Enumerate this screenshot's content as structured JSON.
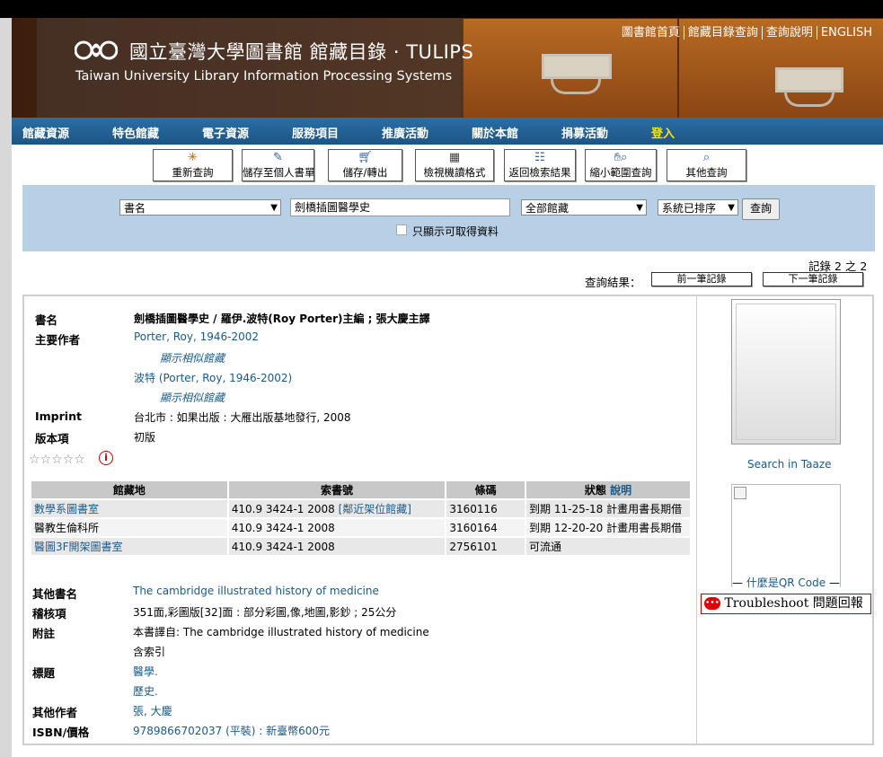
{
  "header": {
    "title_cn": "國立臺灣大學圖書館 館藏目錄 · TULIPS",
    "title_en": "Taiwan University Library Information Processing Systems",
    "top_links": [
      "圖書館首頁",
      "館藏目錄查詢",
      "查詢說明",
      "ENGLISH"
    ]
  },
  "nav": {
    "items": [
      "館藏資源",
      "特色館藏",
      "電子資源",
      "服務項目",
      "推廣活動",
      "關於本館",
      "捐募活動"
    ],
    "login": "登入"
  },
  "toolbar": {
    "buttons": [
      {
        "label": "重新查詢",
        "icon": "new-search-icon"
      },
      {
        "label": "儲存至個人書單",
        "icon": "save-list-icon"
      },
      {
        "label": "儲存/轉出",
        "icon": "cart-icon"
      },
      {
        "label": "檢視機讀格式",
        "icon": "marc-icon"
      },
      {
        "label": "返回檢索結果",
        "icon": "back-results-icon"
      },
      {
        "label": "縮小範圍查詢",
        "icon": "narrow-search-icon"
      },
      {
        "label": "其他查詢",
        "icon": "magnifier-icon"
      }
    ]
  },
  "search": {
    "field_select": "書名",
    "query": "劍橋插圖醫學史",
    "scope_select": "全部館藏",
    "sort_select": "系統已排序",
    "submit": "查詢",
    "available_only": "只顯示可取得資料",
    "available_only_checked": false
  },
  "record_nav": {
    "position": "記錄 2 之 2",
    "results_label": "查詢結果：",
    "prev": "前一筆記錄",
    "next": "下一筆記錄"
  },
  "record": {
    "title_label": "書名",
    "title_value": "劍橋插圖醫學史 / 羅伊.波特(Roy Porter)主編 ; 張大慶主譯",
    "author_label": "主要作者",
    "authors": [
      {
        "name": "Porter, Roy, 1946-2002",
        "similar": "顯示相似館藏"
      },
      {
        "name": "波特 (Porter, Roy, 1946-2002)",
        "similar": "顯示相似館藏"
      }
    ],
    "imprint_label": "Imprint",
    "imprint_value": "台北市 : 如果出版 : 大雁出版基地發行, 2008",
    "edition_label": "版本項",
    "edition_value": "初版",
    "rating": 0,
    "rating_max": 5
  },
  "holdings": {
    "headers": [
      "館藏地",
      "索書號",
      "條碼",
      "狀態"
    ],
    "status_help": "說明",
    "rows": [
      {
        "location": "數學系圖書室",
        "callno": "410.9 3424-1 2008",
        "shelf": "[鄰近架位館藏]",
        "barcode": "3160116",
        "status": "到期 11-25-18 計畫用書長期借",
        "location_link": true
      },
      {
        "location": "醫教生倫科所",
        "callno": "410.9 3424-1 2008",
        "shelf": "",
        "barcode": "3160164",
        "status": "到期 12-20-20 計畫用書長期借",
        "location_link": false
      },
      {
        "location": "醫圖3F開架圖書室",
        "callno": "410.9 3424-1 2008",
        "shelf": "",
        "barcode": "2756101",
        "status": "可流通",
        "location_link": true
      }
    ]
  },
  "details": {
    "other_title_label": "其他書名",
    "other_title": "The cambridge illustrated history of medicine",
    "collation_label": "稽核項",
    "collation": "351面,彩圖版[32]面 : 部分彩圖,像,地圖,影鈔 ; 25公分",
    "notes_label": "附註",
    "notes": [
      "本書譯自: The cambridge illustrated history of medicine",
      "含索引"
    ],
    "subject_label": "標題",
    "subjects": [
      "醫學.",
      "歷史."
    ],
    "other_author_label": "其他作者",
    "other_author": "張, 大慶",
    "isbn_label": "ISBN/價格",
    "isbn": "9789866702037 (平裝) : 新臺幣600元"
  },
  "sidebar": {
    "taaze": "Search in Taaze",
    "qr_label": "什麼是QR Code",
    "troubleshoot_en": "Troubleshoot",
    "troubleshoot_cn": "問題回報"
  },
  "colors": {
    "nav_bg": "#1c5584",
    "search_panel": "#b8d0e6",
    "link": "#1a5a8a",
    "login": "#ffe600"
  }
}
